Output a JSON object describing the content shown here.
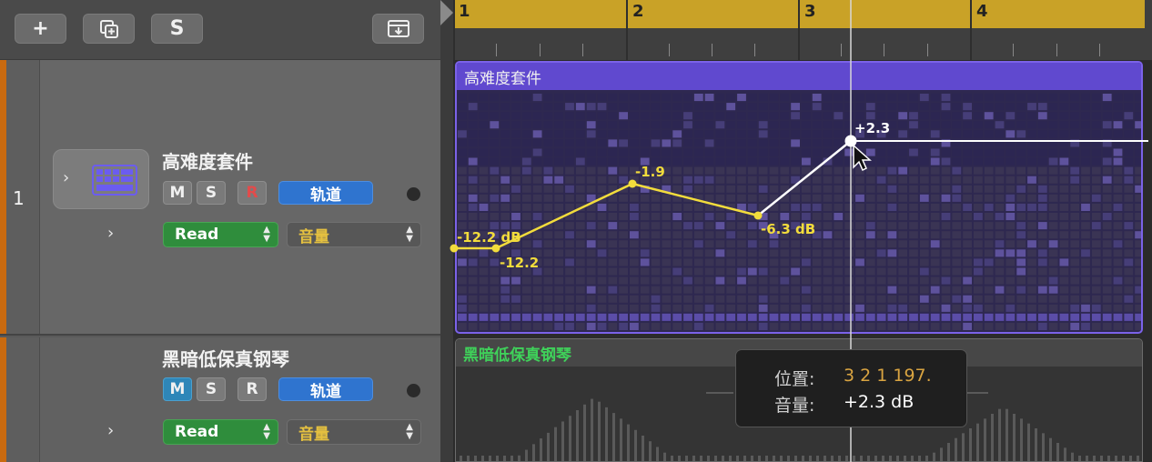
{
  "toolbar": {
    "add_label": "+",
    "duplicate_label": "",
    "s_label": "S",
    "import_label": ""
  },
  "ruler": {
    "bars": [
      "1",
      "2",
      "3",
      "4"
    ]
  },
  "track1": {
    "number": "1",
    "name": "高难度套件",
    "mute": "M",
    "solo": "S",
    "record": "R",
    "track_button": "轨道",
    "automation_mode": "Read",
    "automation_param": "音量",
    "region_name": "高难度套件",
    "automation_points": [
      {
        "label": "-12.2 dB"
      },
      {
        "label": "-12.2"
      },
      {
        "label": "-1.9"
      },
      {
        "label": "-6.3 dB"
      },
      {
        "label": "+2.3"
      }
    ]
  },
  "track2": {
    "name": "黑暗低保真钢琴",
    "mute": "M",
    "solo": "S",
    "record": "R",
    "track_button": "轨道",
    "automation_mode": "Read",
    "automation_param": "音量",
    "region_name": "黑暗低保真钢琴"
  },
  "tooltip": {
    "position_label": "位置:",
    "position_value": "3 2 1 197.",
    "volume_label": "音量:",
    "volume_value": "+2.3 dB"
  },
  "colors": {
    "ruler": "#c9a227",
    "region1": "#6049cf",
    "automation_line": "#f2dc3c",
    "region2_name": "#3fd15a",
    "track_button": "#2f74cf",
    "read_button": "#2f8d3c",
    "tooltip_position": "#d9a441"
  },
  "icons": [
    "plus-icon",
    "duplicate-track-icon",
    "import-icon",
    "drum-machine-icon",
    "chevron-right-icon",
    "mouse-pointer-icon"
  ]
}
